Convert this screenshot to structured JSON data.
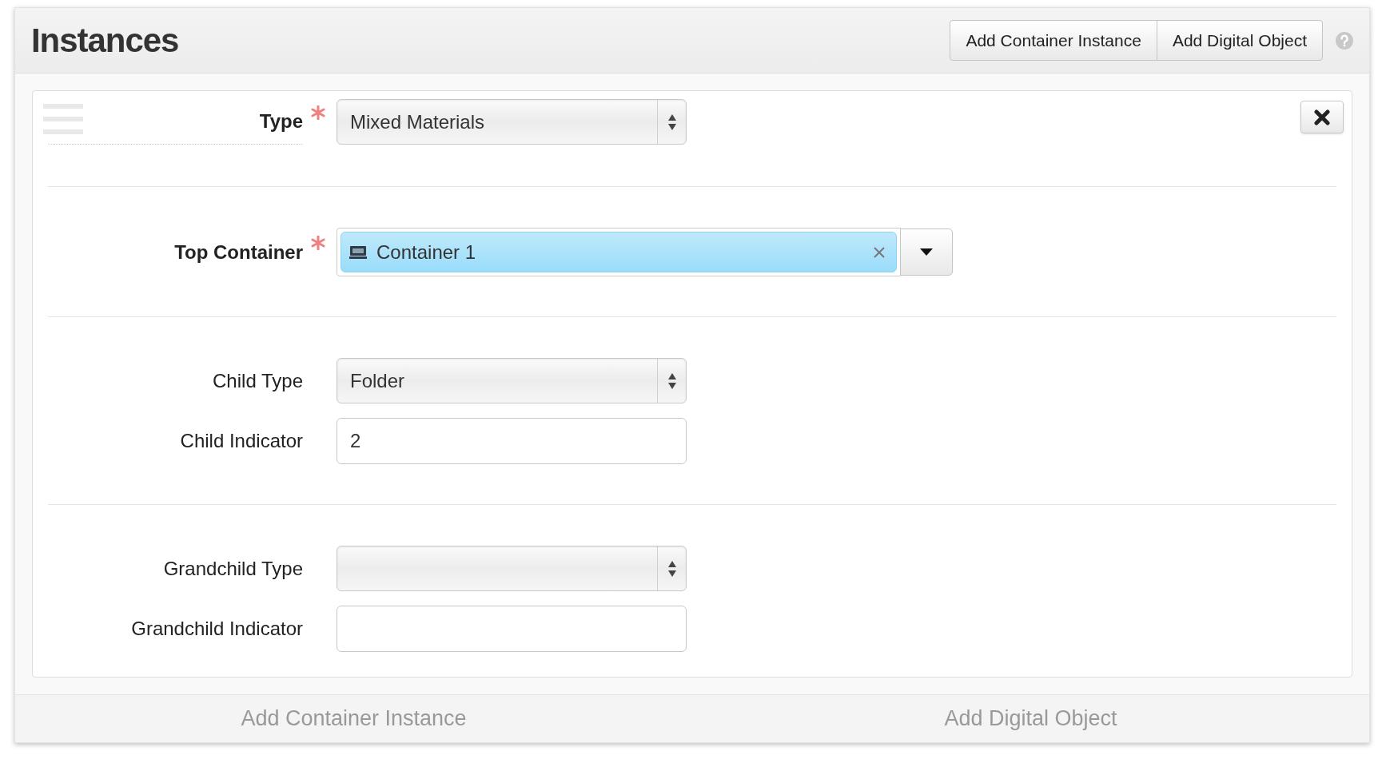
{
  "header": {
    "title": "Instances",
    "buttons": [
      "Add Container Instance",
      "Add Digital Object"
    ]
  },
  "sections": [
    [
      {
        "kind": "select",
        "label": "Type",
        "required": true,
        "value": "Mixed Materials"
      }
    ],
    [
      {
        "kind": "token",
        "label": "Top Container",
        "required": true,
        "value": "Container 1"
      }
    ],
    [
      {
        "kind": "select",
        "label": "Child Type",
        "required": false,
        "value": "Folder"
      },
      {
        "kind": "text",
        "label": "Child Indicator",
        "required": false,
        "value": "2"
      }
    ],
    [
      {
        "kind": "select",
        "label": "Grandchild Type",
        "required": false
      },
      {
        "kind": "text",
        "label": "Grandchild Indicator",
        "required": false
      }
    ]
  ],
  "footer": [
    "Add Container Instance",
    "Add Digital Object"
  ]
}
